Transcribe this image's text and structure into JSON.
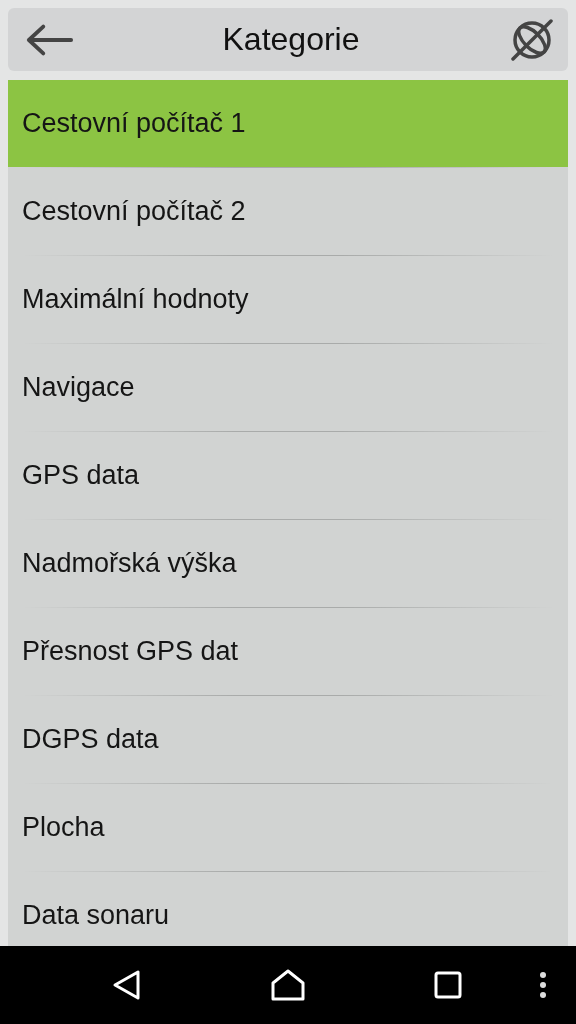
{
  "header": {
    "title": "Kategorie"
  },
  "categories": [
    {
      "label": "Cestovní počítač 1",
      "selected": true
    },
    {
      "label": "Cestovní počítač 2",
      "selected": false
    },
    {
      "label": "Maximální hodnoty",
      "selected": false
    },
    {
      "label": "Navigace",
      "selected": false
    },
    {
      "label": "GPS data",
      "selected": false
    },
    {
      "label": "Nadmořská výška",
      "selected": false
    },
    {
      "label": "Přesnost GPS dat",
      "selected": false
    },
    {
      "label": "DGPS data",
      "selected": false
    },
    {
      "label": "Plocha",
      "selected": false
    },
    {
      "label": "Data sonaru",
      "selected": false
    }
  ]
}
